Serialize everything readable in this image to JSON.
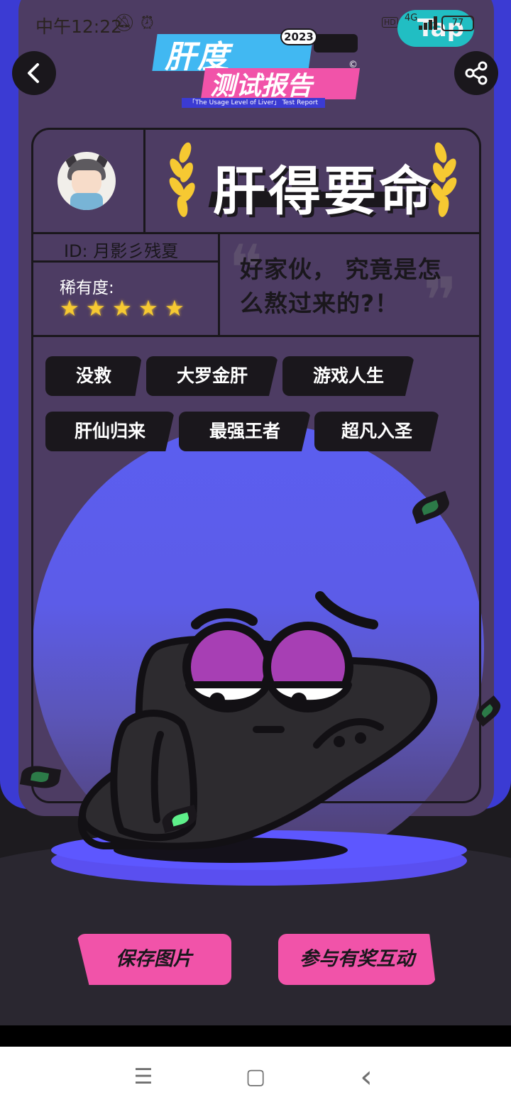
{
  "status_bar": {
    "time": "中午12:22",
    "hd": "HD",
    "network": "4G",
    "battery": "77",
    "overlay_badge": "Tap"
  },
  "header": {
    "logo_line1": "肝度",
    "logo_badge": "2023",
    "logo_line2": "测试报告",
    "logo_copyright": "©",
    "logo_subtitle": "「The Usage Level of Liver」 Test Report",
    "back_icon": "chevron-left-icon",
    "share_icon": "share-icon"
  },
  "card": {
    "title": "肝得要命",
    "id_text": "ID: 月影彡残夏",
    "rarity_label": "稀有度:",
    "rarity_stars": 5,
    "quote": "好家伙， 究竟是怎么熬过来的?！",
    "quote_open": "❝",
    "quote_close": "❞",
    "tags_row1": [
      "没救",
      "大罗金肝",
      "游戏人生"
    ],
    "tags_row2": [
      "肝仙归来",
      "最强王者",
      "超凡入圣"
    ]
  },
  "actions": {
    "save_label": "保存图片",
    "join_label": "参与有奖互动"
  },
  "navbar": {
    "menu_icon": "☰",
    "home_icon": "▢",
    "back_icon": "‹"
  },
  "colors": {
    "card_bg": "#4d3c63",
    "accent_blue": "#3b3bd3",
    "accent_pink": "#f153a9",
    "star_gold": "#f6c932",
    "moon_blue": "#5b5ef0"
  }
}
